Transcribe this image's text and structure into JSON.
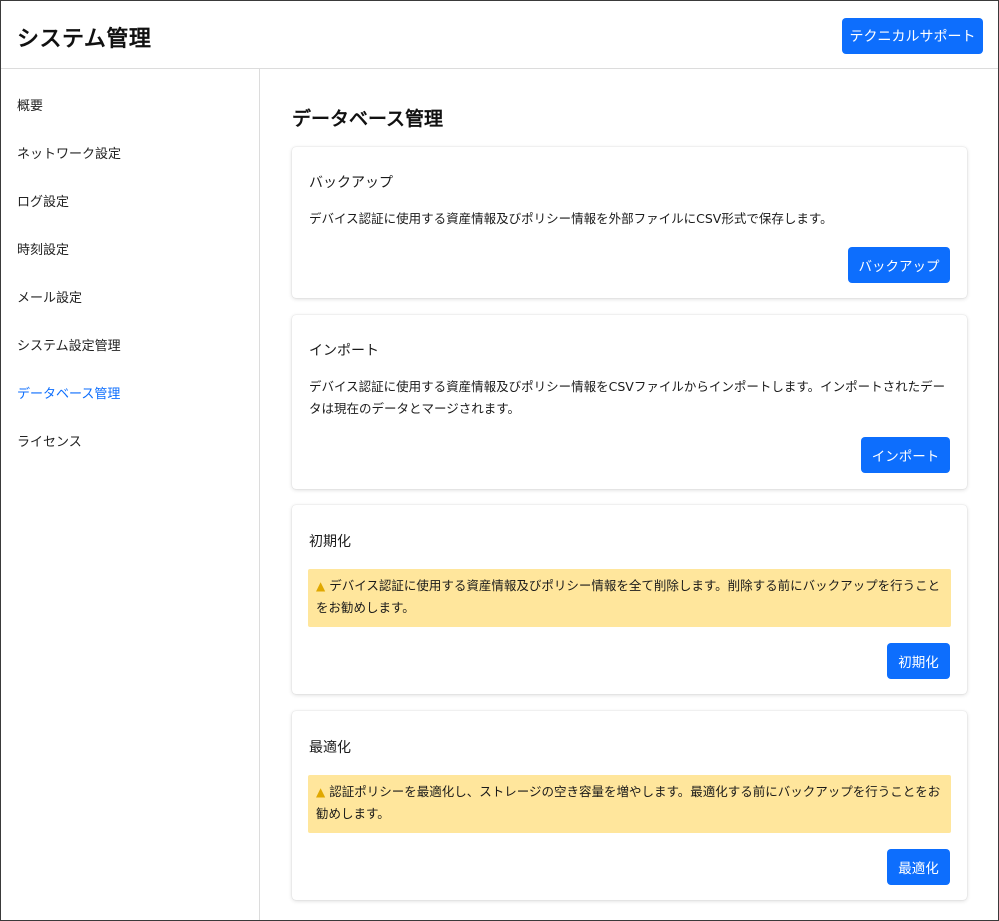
{
  "header": {
    "title": "システム管理",
    "support_button": "テクニカルサポート"
  },
  "sidebar": {
    "items": [
      {
        "label": "概要"
      },
      {
        "label": "ネットワーク設定"
      },
      {
        "label": "ログ設定"
      },
      {
        "label": "時刻設定"
      },
      {
        "label": "メール設定"
      },
      {
        "label": "システム設定管理"
      },
      {
        "label": "データベース管理",
        "active": true
      },
      {
        "label": "ライセンス"
      }
    ]
  },
  "main": {
    "title": "データベース管理",
    "cards": [
      {
        "title": "バックアップ",
        "description": "デバイス認証に使用する資産情報及びポリシー情報を外部ファイルにCSV形式で保存します。",
        "button": "バックアップ"
      },
      {
        "title": "インポート",
        "description": "デバイス認証に使用する資産情報及びポリシー情報をCSVファイルからインポートします。インポートされたデータは現在のデータとマージされます。",
        "button": "インポート"
      },
      {
        "title": "初期化",
        "warning": "デバイス認証に使用する資産情報及びポリシー情報を全て削除します。削除する前にバックアップを行うことをお勧めします。",
        "button": "初期化"
      },
      {
        "title": "最適化",
        "warning": "認証ポリシーを最適化し、ストレージの空き容量を増やします。最適化する前にバックアップを行うことをお勧めします。",
        "button": "最適化"
      }
    ]
  },
  "colors": {
    "accent": "#0d6efd",
    "warning_bg": "#ffe69c",
    "warning_icon": "#e0a800"
  },
  "icons": {
    "warning": "warning-triangle-icon"
  }
}
